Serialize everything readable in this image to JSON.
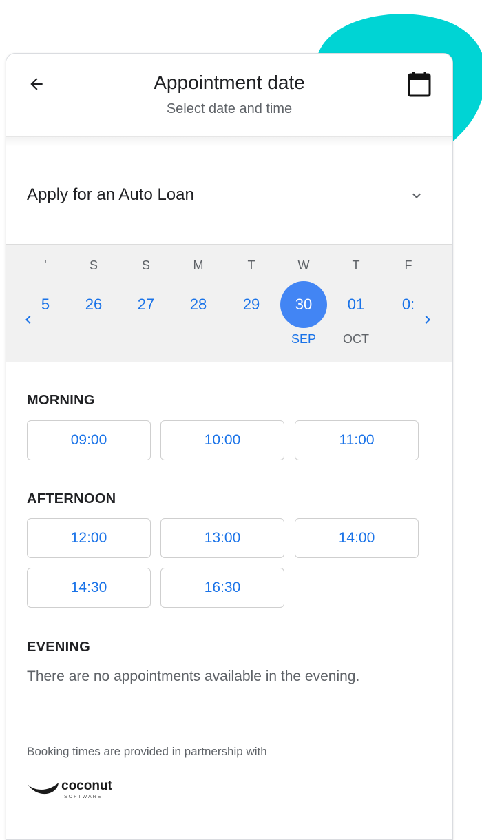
{
  "header": {
    "title": "Appointment date",
    "subtitle": "Select date and time"
  },
  "service": {
    "label": "Apply for an Auto Loan"
  },
  "date_strip": {
    "days": [
      {
        "dow": "'",
        "num": "5",
        "month": "",
        "selected": false
      },
      {
        "dow": "S",
        "num": "26",
        "month": "",
        "selected": false
      },
      {
        "dow": "S",
        "num": "27",
        "month": "",
        "selected": false
      },
      {
        "dow": "M",
        "num": "28",
        "month": "",
        "selected": false
      },
      {
        "dow": "T",
        "num": "29",
        "month": "",
        "selected": false
      },
      {
        "dow": "W",
        "num": "30",
        "month": "SEP",
        "selected": true
      },
      {
        "dow": "T",
        "num": "01",
        "month": "OCT",
        "selected": false
      },
      {
        "dow": "F",
        "num": "0:",
        "month": "",
        "selected": false
      }
    ]
  },
  "sections": {
    "morning": {
      "title": "MORNING",
      "slots": [
        "09:00",
        "10:00",
        "11:00"
      ]
    },
    "afternoon": {
      "title": "AFTERNOON",
      "slots": [
        "12:00",
        "13:00",
        "14:00",
        "14:30",
        "16:30"
      ]
    },
    "evening": {
      "title": "EVENING",
      "empty_message": "There are no appointments available in the evening."
    }
  },
  "footer": {
    "partner_note": "Booking times are provided in partnership with",
    "logo_word": "coconut",
    "logo_sub": "SOFTWARE"
  },
  "colors": {
    "accent": "#1a73e8",
    "selected": "#4285f4",
    "blob": "#00d4d4"
  },
  "icons": {
    "back": "arrow-left-icon",
    "calendar": "calendar-icon",
    "expand": "chevron-down-icon",
    "prev": "chevron-left-icon",
    "next": "chevron-right-icon"
  }
}
